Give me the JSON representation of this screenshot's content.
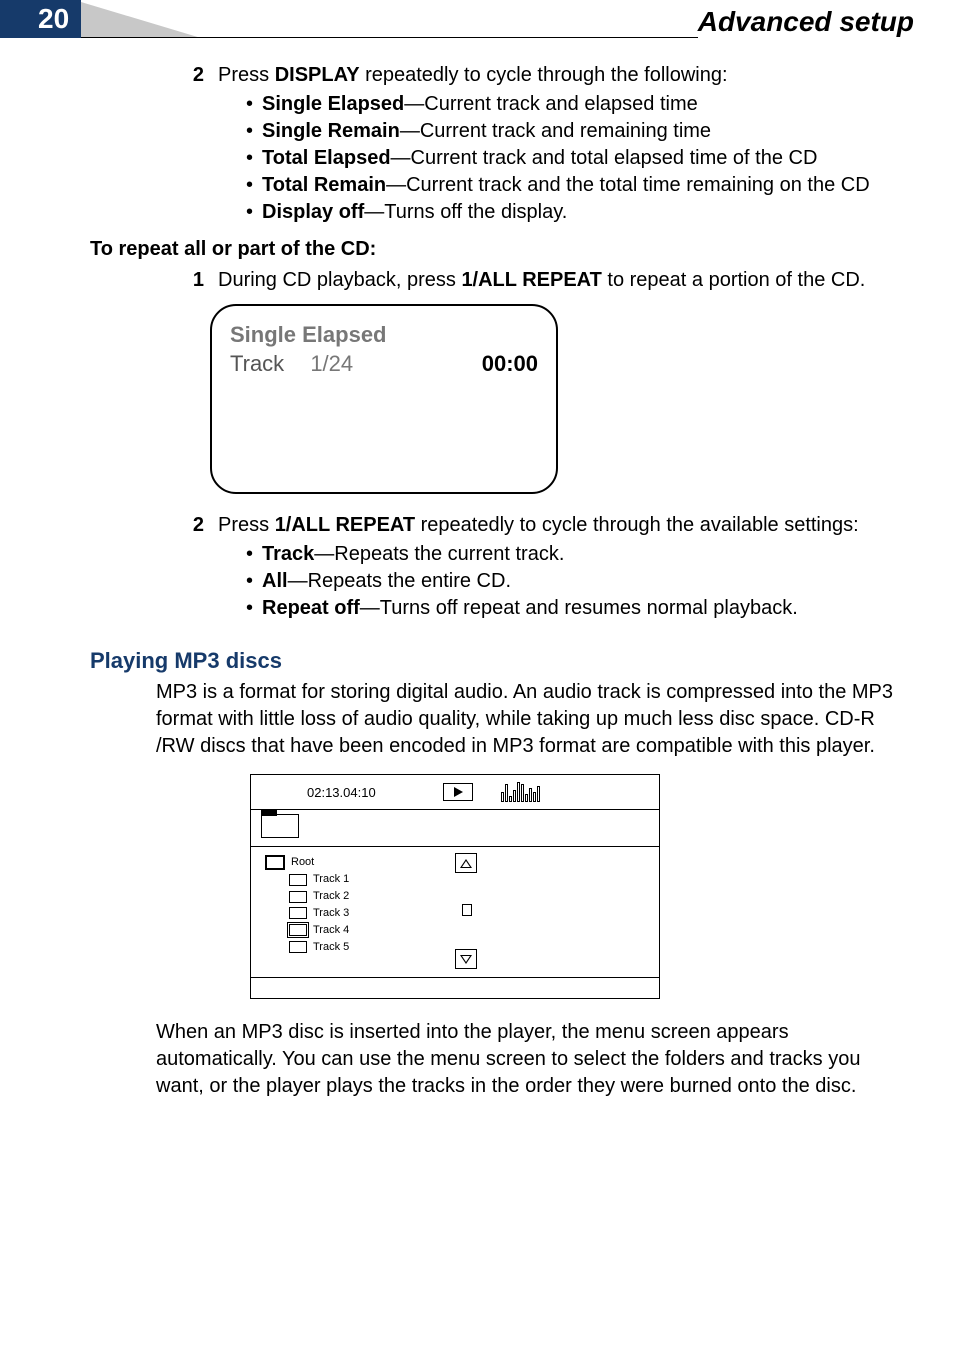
{
  "header": {
    "page_number": "20",
    "chapter_title": "Advanced setup"
  },
  "step2": {
    "num": "2",
    "lead_a": "Press ",
    "lead_key": "DISPLAY",
    "lead_b": " repeatedly to cycle through the following:",
    "items": [
      {
        "term": "Single Elapsed",
        "desc": "—Current track and elapsed time"
      },
      {
        "term": "Single Remain",
        "desc": "—Current track and remaining time"
      },
      {
        "term": "Total Elapsed",
        "desc": "—Current track and total elapsed time of the CD"
      },
      {
        "term": "Total Remain",
        "desc": "—Current track and the total time remaining on the CD"
      },
      {
        "term": "Display off",
        "desc": "—Turns off the display."
      }
    ]
  },
  "repeat_heading": "To repeat all or part of the CD:",
  "repeat_step1": {
    "num": "1",
    "a": "During CD playback, press ",
    "key": "1/ALL REPEAT",
    "b": " to repeat a portion of the CD."
  },
  "osd": {
    "line1": "Single Elapsed",
    "track_label": "Track",
    "track_num": "1/24",
    "time": "00:00"
  },
  "repeat_step2": {
    "num": "2",
    "a": "Press ",
    "key": "1/ALL REPEAT",
    "b": " repeatedly to cycle through the available settings:",
    "items": [
      {
        "term": "Track",
        "desc": "—Repeats the current track."
      },
      {
        "term": "All",
        "desc": "—Repeats the entire CD."
      },
      {
        "term": "Repeat off",
        "desc": "—Turns off repeat and resumes normal playback."
      }
    ]
  },
  "mp3_heading": "Playing MP3 discs",
  "mp3_para1": "MP3 is a format for storing digital audio. An audio track is compressed into the MP3 format with little loss of audio quality, while taking up much less disc space. CD-R /RW discs that have been encoded in MP3 format are compatible with this player.",
  "mp3_menu": {
    "timestamp": "02:13.04:10",
    "root": "Root",
    "tracks": [
      "Track 1",
      "Track 2",
      "Track 3",
      "Track 4",
      "Track 5"
    ]
  },
  "mp3_para2": "When an MP3 disc is inserted into the player, the menu screen appears automatically. You can use the menu screen to select the folders and tracks you want, or the player plays the tracks in the order they were burned onto the disc."
}
